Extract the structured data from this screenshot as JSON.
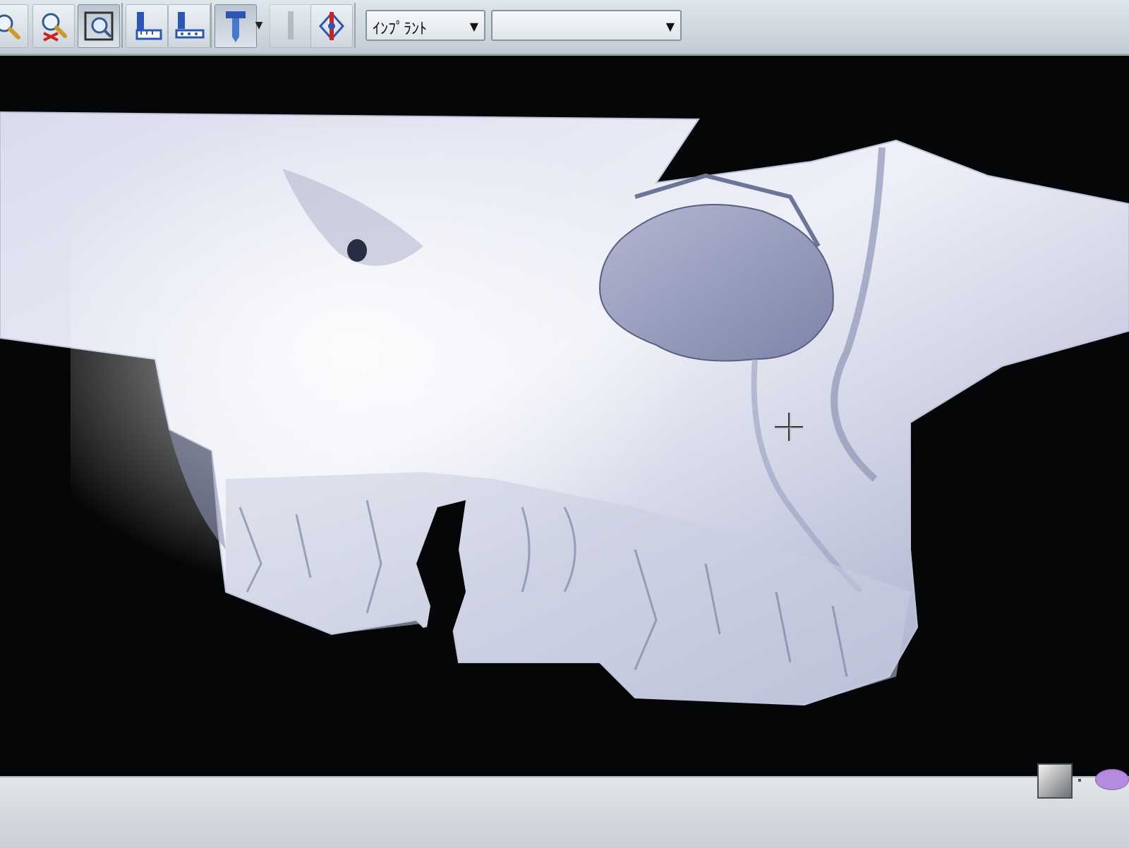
{
  "toolbar": {
    "buttons": [
      {
        "name": "zoom-in-icon"
      },
      {
        "name": "zoom-reset-icon"
      },
      {
        "name": "fit-view-icon"
      },
      {
        "name": "measure-length-icon"
      },
      {
        "name": "measure-angle-icon"
      },
      {
        "name": "implant-tool-icon"
      },
      {
        "name": "disabled-tool-icon"
      },
      {
        "name": "axis-tool-icon"
      }
    ],
    "implant_combo_value": "ｲﾝﾌﾟﾗﾝﾄ",
    "second_combo_value": ""
  },
  "viewport": {
    "content": "3d-maxilla-render"
  },
  "statusbar": {
    "swatch_color": "#b58bde"
  }
}
